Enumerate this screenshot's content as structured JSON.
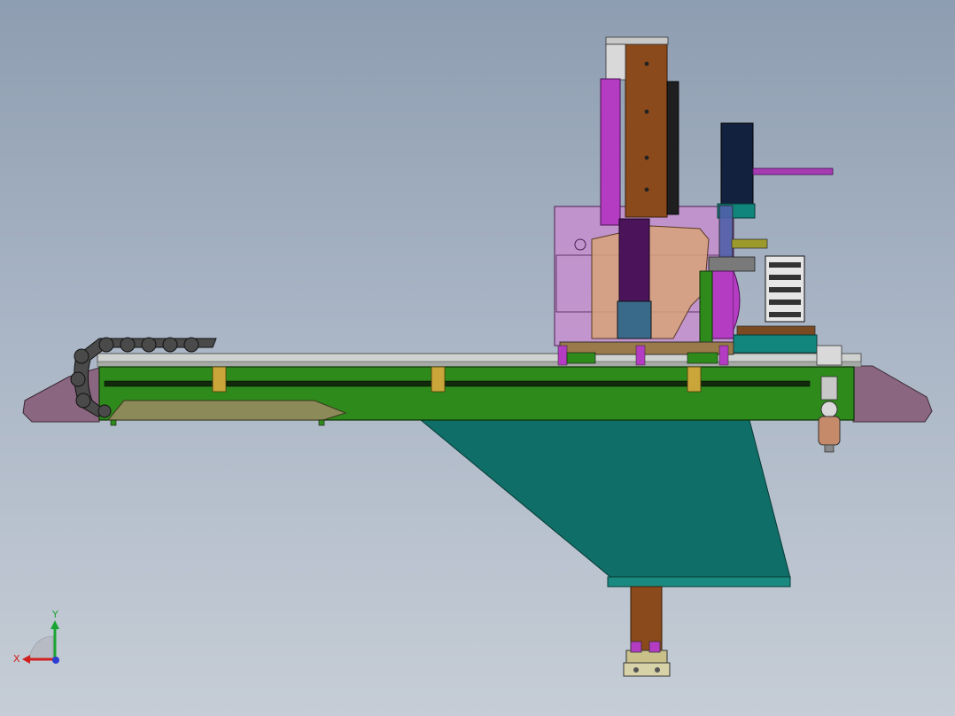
{
  "viewport": {
    "background_top": "#8e9db1",
    "background_bottom": "#c6cdd6"
  },
  "model": {
    "parts": [
      "cable-chain",
      "end-cap-left",
      "end-cap-right",
      "gantry-beam",
      "linear-rail",
      "support-bracket",
      "vertical-z-column",
      "carriage-housing",
      "pneumatic-cylinder",
      "servo-motor",
      "air-filter-regulator",
      "gripper-end-effector"
    ],
    "colors": {
      "beam_green": "#2f8a1c",
      "bracket_teal": "#0f6e67",
      "column_brown": "#8a4a1b",
      "housing_purple": "#c98ccf",
      "cylinder_magenta": "#b43cc2",
      "endcap_mauve": "#8a6680",
      "chain_gray": "#4a4a4a"
    }
  },
  "triad": {
    "x_label": "X",
    "y_label": "Y",
    "x_color": "#d11f1f",
    "y_color": "#1aa532",
    "z_color": "#2b3ed1"
  }
}
